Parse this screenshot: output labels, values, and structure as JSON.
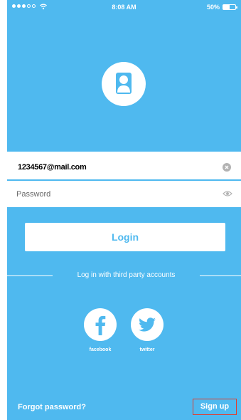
{
  "status_bar": {
    "time": "8:08 AM",
    "battery_percent": "50%",
    "battery_level": 0.5,
    "signal_bars_filled": 3,
    "signal_bars_total": 5
  },
  "login_form": {
    "email_value": "1234567@mail.com",
    "password_placeholder": "Password",
    "login_label": "Login"
  },
  "third_party": {
    "divider_text": "Log in with third party accounts",
    "facebook_label": "facebook",
    "twitter_label": "twitter"
  },
  "footer": {
    "forgot_label": "Forgot password?",
    "signup_label": "Sign up"
  },
  "colors": {
    "background": "#4fb9ef",
    "field_background": "#ffffff",
    "signup_border": "#e23c2c"
  }
}
